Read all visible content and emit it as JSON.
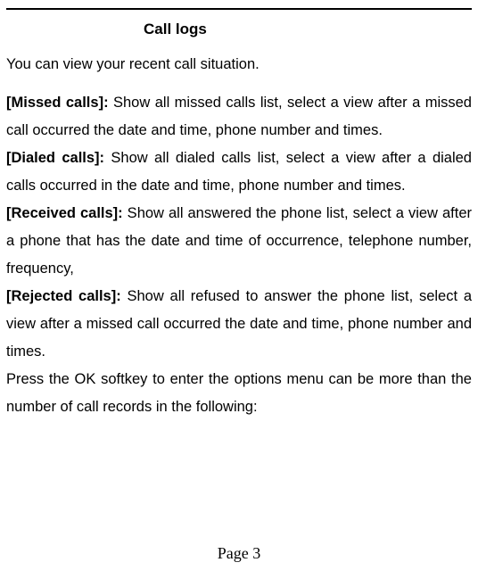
{
  "title": "Call logs",
  "intro": "You can view your recent call situation.",
  "sections": {
    "missed": {
      "label": "[Missed calls]:",
      "text": " Show all missed calls list, select a view after a missed call occurred the date and time, phone number and times."
    },
    "dialed": {
      "label": "[Dialed calls]:",
      "text": " Show all dialed calls list, select a view after a dialed calls occurred in the date and time, phone number and times."
    },
    "received": {
      "label": "[Received calls]:",
      "text": " Show all answered the phone list, select a view after a phone that has the date and time of occurrence, telephone number, frequency,"
    },
    "rejected": {
      "label": "[Rejected calls]:",
      "text": " Show all refused to answer the phone list, select a view after a missed call occurred the date and time, phone number and times."
    }
  },
  "closing": "Press the OK softkey to enter the options menu can be more than the number of call records in the following:",
  "footer": "Page 3"
}
